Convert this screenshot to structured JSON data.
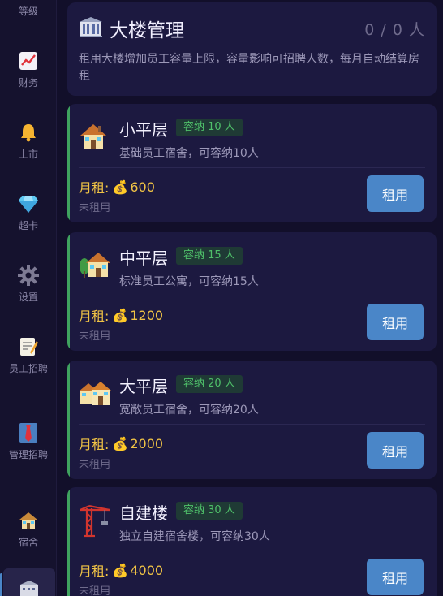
{
  "sidebar": {
    "items": [
      {
        "label": "等级",
        "icon": "level-icon"
      },
      {
        "label": "财务",
        "icon": "chart-icon"
      },
      {
        "label": "上市",
        "icon": "bell-icon"
      },
      {
        "label": "超卡",
        "icon": "diamond-icon"
      },
      {
        "label": "设置",
        "icon": "gear-icon"
      },
      {
        "label": "员工招聘",
        "icon": "memo-icon"
      },
      {
        "label": "管理招聘",
        "icon": "tie-icon"
      },
      {
        "label": "宿舍",
        "icon": "house-icon"
      },
      {
        "label": "",
        "icon": "building-icon",
        "active": true
      }
    ]
  },
  "header": {
    "title": "大楼管理",
    "count": "0 / 0 人",
    "description": "租用大楼增加员工容量上限，容量影响可招聘人数，每月自动结算房租"
  },
  "floors": [
    {
      "name": "小平层",
      "capacity": "容纳 10 人",
      "desc": "基础员工宿舍，可容纳10人",
      "rent_label": "月租:",
      "rent": "600",
      "status": "未租用",
      "button": "租用"
    },
    {
      "name": "中平层",
      "capacity": "容纳 15 人",
      "desc": "标准员工公寓，可容纳15人",
      "rent_label": "月租:",
      "rent": "1200",
      "status": "未租用",
      "button": "租用"
    },
    {
      "name": "大平层",
      "capacity": "容纳 20 人",
      "desc": "宽敞员工宿舍，可容纳20人",
      "rent_label": "月租:",
      "rent": "2000",
      "status": "未租用",
      "button": "租用"
    },
    {
      "name": "自建楼",
      "capacity": "容纳 30 人",
      "desc": "独立自建宿舍楼，可容纳30人",
      "rent_label": "月租:",
      "rent": "4000",
      "status": "未租用",
      "button": "租用"
    }
  ],
  "colors": {
    "accent": "#4a86c8",
    "capacity_green": "#4fc06a",
    "rent_gold": "#f0c345",
    "background": "#120f2a",
    "card": "#1c1940"
  }
}
